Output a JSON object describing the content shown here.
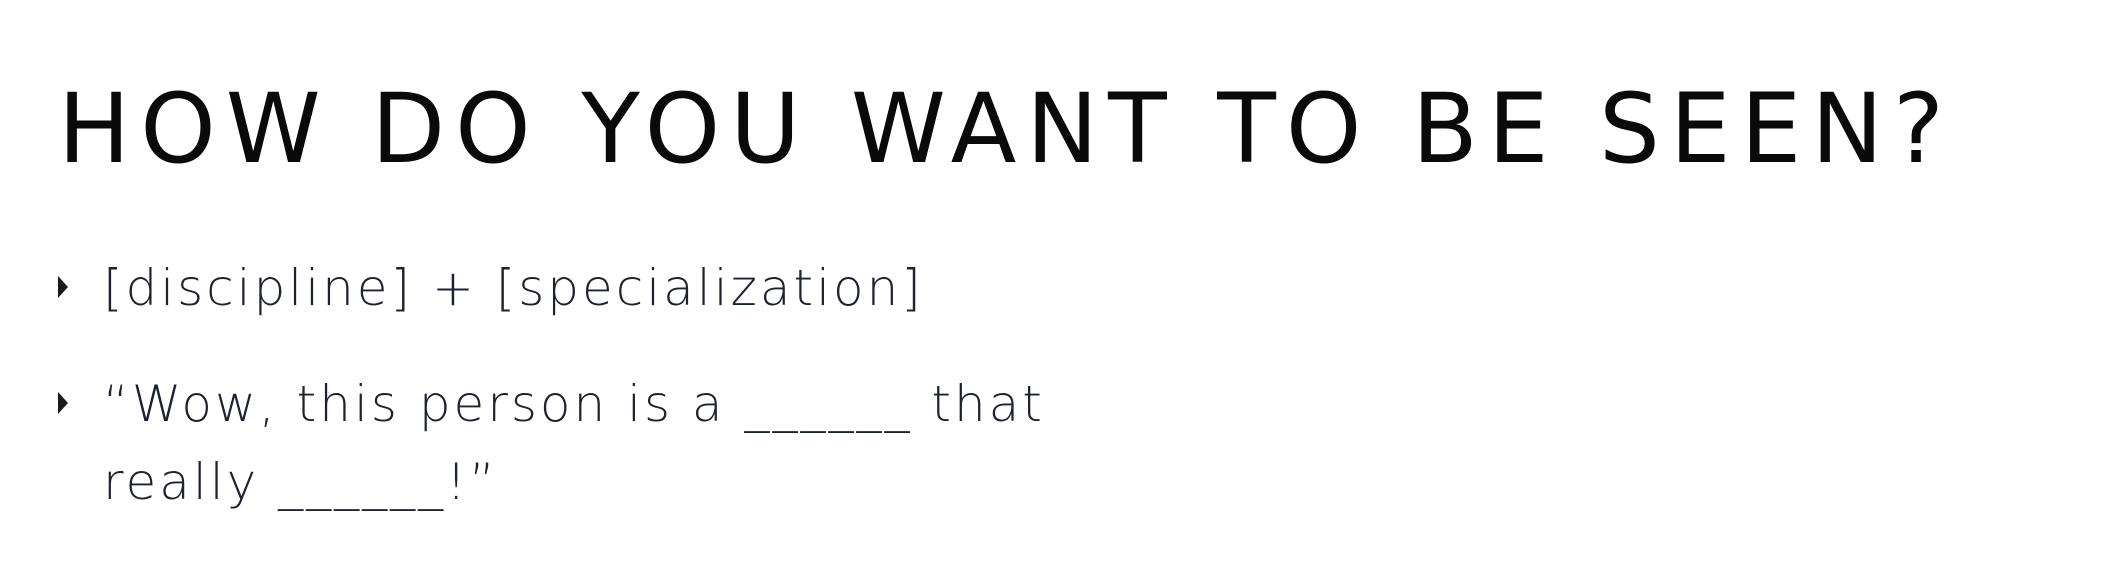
{
  "slide": {
    "title": "HOW DO YOU WANT TO BE SEEN?",
    "bullets": [
      {
        "text": "[discipline] + [specialization]"
      },
      {
        "text": "“Wow, this person is a ______ that really ______!”"
      }
    ]
  },
  "icons": {
    "bullet_marker": "triangle-right-icon"
  },
  "colors": {
    "background": "#ffffff",
    "title_text": "#0a0a0a",
    "body_text": "#1b2230"
  }
}
